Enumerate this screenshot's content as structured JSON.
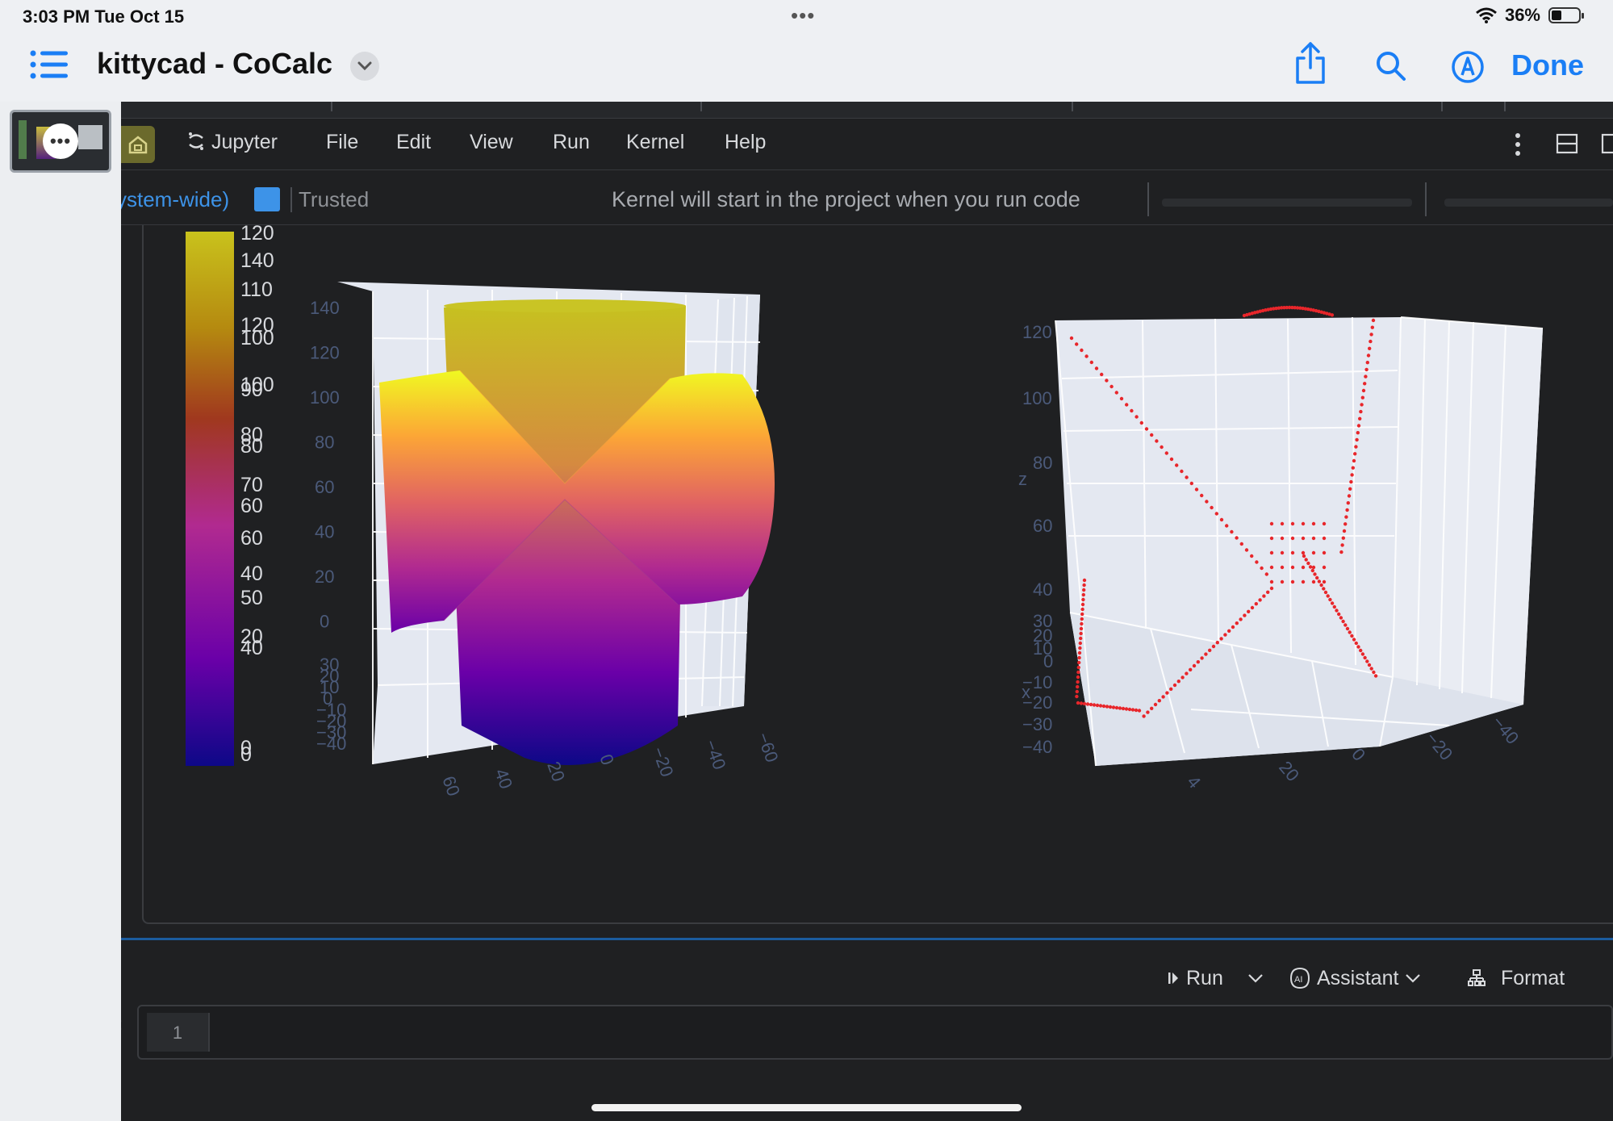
{
  "status_bar": {
    "time": "3:03 PM  Tue Oct 15",
    "dots": "•••",
    "battery": "36%",
    "battery_level": 0.36
  },
  "nav": {
    "title": "kittycad - CoCalc",
    "done": "Done",
    "icons": [
      "list-icon",
      "chevron-down-icon",
      "share-icon",
      "search-icon",
      "markup-icon"
    ]
  },
  "menu": {
    "items": [
      "Jupyter",
      "File",
      "Edit",
      "View",
      "Run",
      "Kernel",
      "Help"
    ]
  },
  "status": {
    "kernel": "ystem-wide)",
    "trusted": "Trusted",
    "message": "Kernel will start in the project when you run code",
    "accent": "#3d93e8"
  },
  "chart_data": [
    {
      "type": "surface",
      "colorbar_ticks": [
        "120",
        "140",
        "110",
        "120",
        "100",
        "100",
        "90",
        "80",
        "80",
        "70",
        "60",
        "60",
        "40",
        "50",
        "20",
        "40",
        "0",
        "0"
      ],
      "z_ticks": [
        "140",
        "120",
        "100",
        "80",
        "60",
        "40",
        "20",
        "0"
      ],
      "x_ticks": [
        "30",
        "20",
        "10",
        "0",
        "−10",
        "−20",
        "−30",
        "−40"
      ],
      "y_ticks": [
        "60",
        "40",
        "20",
        "0",
        "−20",
        "−40",
        "−60"
      ],
      "colorscale": [
        "#0d0887",
        "#6a00a8",
        "#b12a90",
        "#e16462",
        "#fca636",
        "#f0f921"
      ]
    },
    {
      "type": "scatter3d",
      "z_axis_title": "z",
      "x_axis_title": "x",
      "z_ticks": [
        "120",
        "100",
        "80",
        "60",
        "40",
        "30",
        "20",
        "10",
        "0",
        "−10",
        "−20",
        "−30",
        "−40"
      ],
      "y_ticks": [
        "4",
        "20",
        "0",
        "−20",
        "−40"
      ],
      "marker_color": "#e8262b"
    }
  ],
  "cell": {
    "run": "Run",
    "assistant": "Assistant",
    "format": "Format",
    "line_number": "1",
    "prompt": ":"
  }
}
